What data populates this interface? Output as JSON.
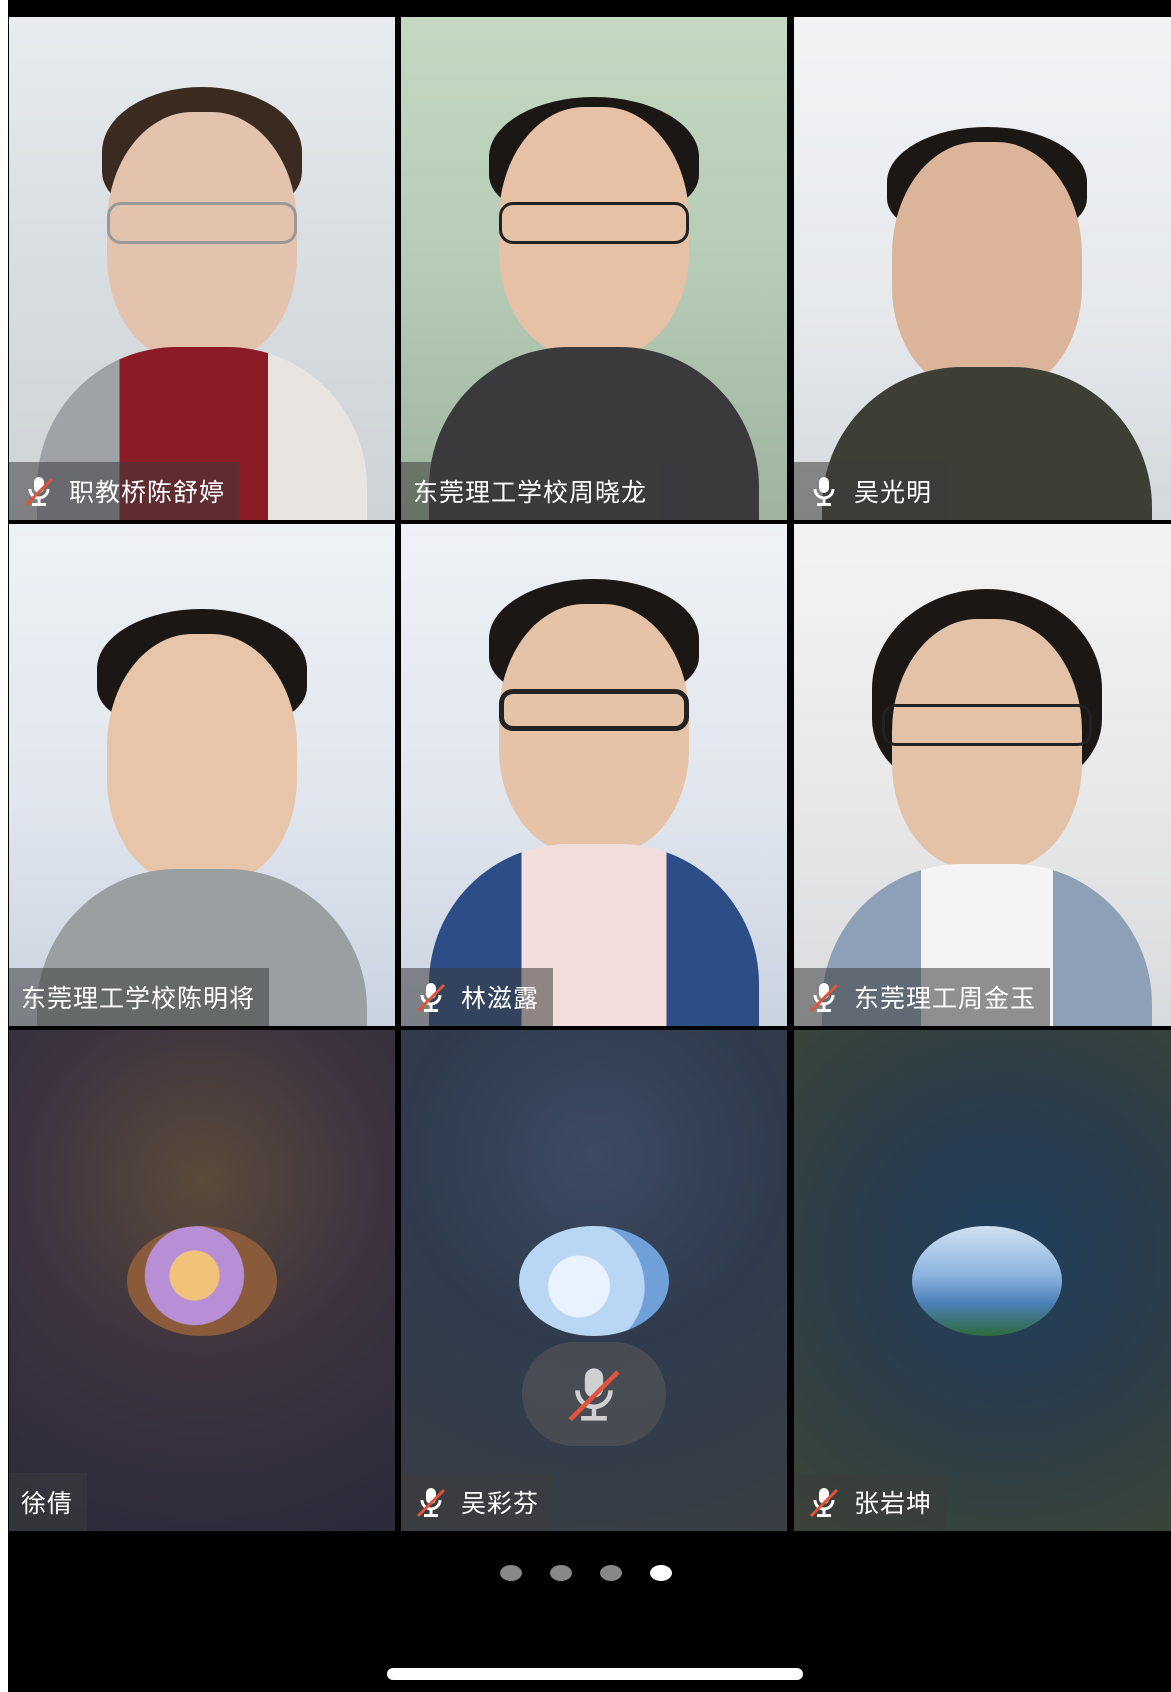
{
  "participants": [
    {
      "name": "职教桥陈舒婷",
      "mic": "muted",
      "kind": "video"
    },
    {
      "name": "东莞理工学校周晓龙",
      "mic": "none",
      "kind": "video"
    },
    {
      "name": "吴光明",
      "mic": "on",
      "kind": "video"
    },
    {
      "name": "东莞理工学校陈明将",
      "mic": "none",
      "kind": "video"
    },
    {
      "name": "林滋露",
      "mic": "muted",
      "kind": "video"
    },
    {
      "name": "东莞理工周金玉",
      "mic": "muted",
      "kind": "video"
    },
    {
      "name": "徐倩",
      "mic": "none",
      "kind": "avatar"
    },
    {
      "name": "吴彩芬",
      "mic": "muted",
      "kind": "avatar"
    },
    {
      "name": "张岩坤",
      "mic": "muted",
      "kind": "avatar"
    }
  ],
  "pager": {
    "pages": 4,
    "current": 4
  },
  "colors": {
    "mute_slash": "#e0553a",
    "tag_bg": "rgba(60,60,60,0.55)",
    "page_dot_active": "#ffffff",
    "page_dot_inactive": "#888888"
  },
  "icons": {
    "muted": "mic-muted-icon",
    "on": "mic-icon"
  }
}
